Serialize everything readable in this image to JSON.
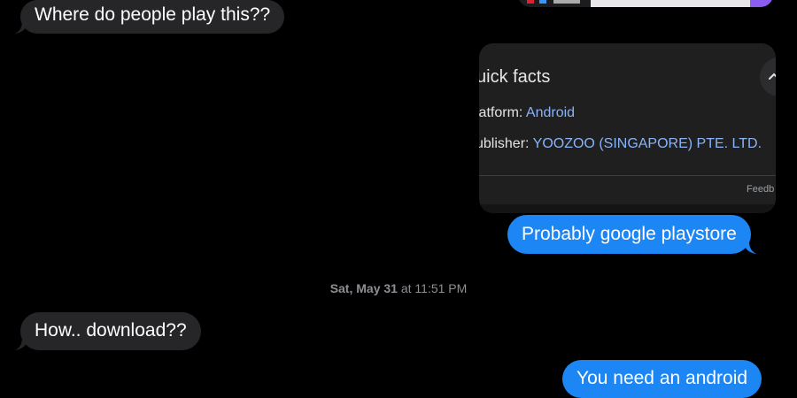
{
  "messages": [
    {
      "id": "m1",
      "direction": "incoming",
      "text": "Where do people play this??"
    },
    {
      "id": "m2",
      "direction": "outgoing",
      "text": "Probably google playstore"
    },
    {
      "id": "m3",
      "direction": "incoming",
      "text": "How.. download??"
    },
    {
      "id": "m4",
      "direction": "outgoing",
      "text": "You need an android"
    }
  ],
  "timestamp": {
    "day": "Sat, May 31",
    "time": "at 11:51 PM"
  },
  "facts_card": {
    "title": "uick facts",
    "platform_label": "latform:",
    "platform_value": "Android",
    "publisher_label": "ublisher:",
    "publisher_value": "YOOZOO (SINGAPORE) PTE. LTD.",
    "feedback": "Feedb"
  },
  "colors": {
    "incoming_bubble": "#262628",
    "outgoing_bubble": "#1d86f5",
    "link_blue": "#8ab4f8",
    "timestamp_gray": "#8e8e93"
  },
  "icons": {
    "collapse": "chevron-up-icon"
  }
}
